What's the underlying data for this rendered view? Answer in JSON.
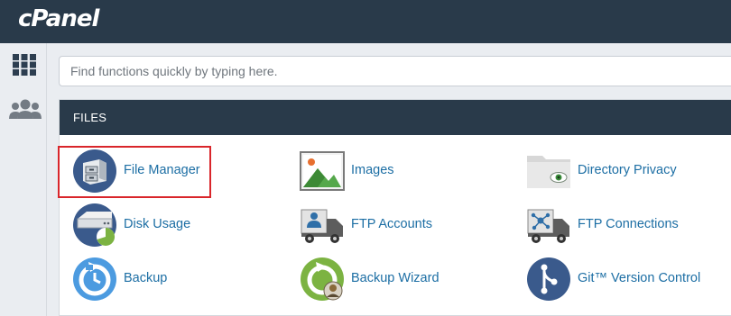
{
  "header": {
    "logo_text": "cPanel"
  },
  "sidebar": {
    "icons": [
      "grid-icon",
      "users-icon"
    ]
  },
  "search": {
    "placeholder": "Find functions quickly by typing here."
  },
  "files": {
    "title": "FILES",
    "items": [
      {
        "label": "File Manager",
        "icon": "file-manager-icon"
      },
      {
        "label": "Images",
        "icon": "images-icon"
      },
      {
        "label": "Directory Privacy",
        "icon": "directory-privacy-icon"
      },
      {
        "label": "Disk Usage",
        "icon": "disk-usage-icon"
      },
      {
        "label": "FTP Accounts",
        "icon": "ftp-accounts-icon"
      },
      {
        "label": "FTP Connections",
        "icon": "ftp-connections-icon"
      },
      {
        "label": "Backup",
        "icon": "backup-icon"
      },
      {
        "label": "Backup Wizard",
        "icon": "backup-wizard-icon"
      },
      {
        "label": "Git™ Version Control",
        "icon": "git-icon"
      }
    ]
  },
  "colors": {
    "header_bg": "#293a4a",
    "link": "#1c6ea4",
    "highlight": "#d9262b",
    "page_bg": "#eaedf1"
  }
}
